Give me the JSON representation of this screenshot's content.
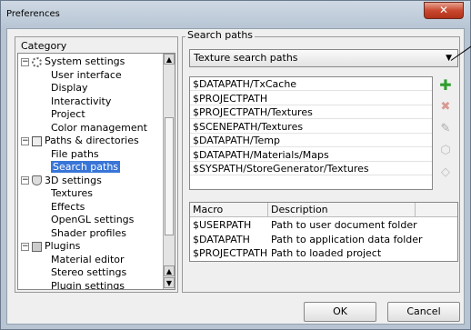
{
  "window": {
    "title": "Preferences"
  },
  "category": {
    "label": "Category",
    "items": [
      {
        "label": "System settings",
        "level": 0,
        "icon": "gear-icon"
      },
      {
        "label": "User interface",
        "level": 1
      },
      {
        "label": "Display",
        "level": 1
      },
      {
        "label": "Interactivity",
        "level": 1
      },
      {
        "label": "Project",
        "level": 1
      },
      {
        "label": "Color management",
        "level": 1
      },
      {
        "label": "Paths & directories",
        "level": 0,
        "icon": "folder-icon"
      },
      {
        "label": "File paths",
        "level": 1
      },
      {
        "label": "Search paths",
        "level": 1,
        "selected": true
      },
      {
        "label": "3D settings",
        "level": 0,
        "icon": "cube-icon"
      },
      {
        "label": "Textures",
        "level": 1
      },
      {
        "label": "Effects",
        "level": 1
      },
      {
        "label": "OpenGL settings",
        "level": 1
      },
      {
        "label": "Shader profiles",
        "level": 1
      },
      {
        "label": "Plugins",
        "level": 0,
        "icon": "plugin-icon"
      },
      {
        "label": "Material editor",
        "level": 1
      },
      {
        "label": "Stereo settings",
        "level": 1
      },
      {
        "label": "Plugin settings",
        "level": 1
      }
    ]
  },
  "search_paths": {
    "label": "Search paths",
    "selected_type": "Texture search paths",
    "paths": [
      "$DATAPATH/TxCache",
      "$PROJECTPATH",
      "$PROJECTPATH/Textures",
      "$SCENEPATH/Textures",
      "$DATAPATH/Temp",
      "$DATAPATH/Materials/Maps",
      "$SYSPATH/StoreGenerator/Textures"
    ],
    "side_buttons": [
      "add-icon",
      "remove-icon",
      "edit-icon",
      "move-up-icon",
      "move-down-icon"
    ],
    "macro_table": {
      "headers": [
        "Macro",
        "Description"
      ],
      "rows": [
        [
          "$USERPATH",
          "Path to user document folder"
        ],
        [
          "$DATAPATH",
          "Path to application data folder"
        ],
        [
          "$PROJECTPATH",
          "Path to loaded project"
        ]
      ]
    }
  },
  "buttons": {
    "ok": "OK",
    "cancel": "Cancel"
  },
  "colors": {
    "selection": "#3875d7",
    "add": "#2e9e2e",
    "remove": "#d04030"
  }
}
